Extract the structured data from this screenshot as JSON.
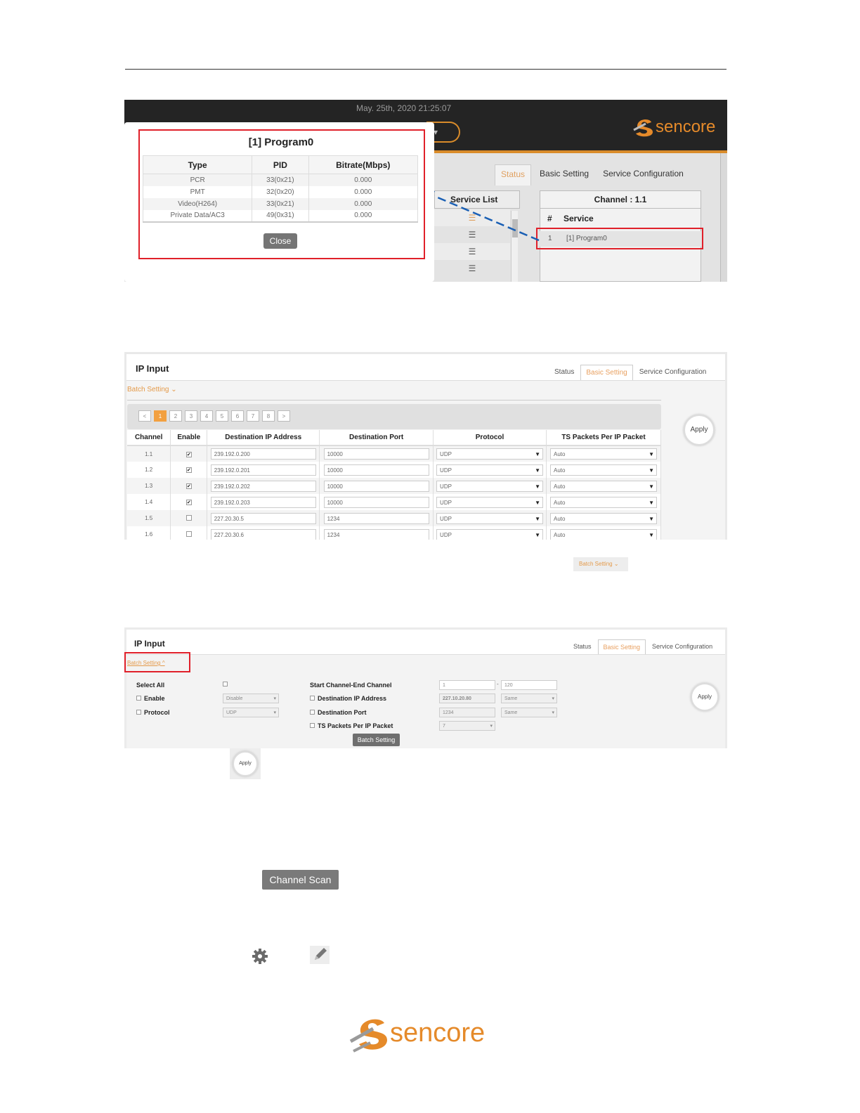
{
  "shot1": {
    "datetime": "May. 25th, 2020 21:25:07",
    "brand": "sencore",
    "tabs": [
      {
        "label": "Status",
        "active": true
      },
      {
        "label": "Basic Setting",
        "active": false
      },
      {
        "label": "Service Configuration",
        "active": false
      }
    ],
    "service_list_title": "Service List",
    "channel_title": "Channel : 1.1",
    "col_hash": "#",
    "col_service": "Service",
    "row_num": "1",
    "row_service": "[1] Program0",
    "popup": {
      "title": "[1] Program0",
      "headers": [
        "Type",
        "PID",
        "Bitrate(Mbps)"
      ],
      "rows": [
        [
          "PCR",
          "33(0x21)",
          "0.000"
        ],
        [
          "PMT",
          "32(0x20)",
          "0.000"
        ],
        [
          "Video(H264)",
          "33(0x21)",
          "0.000"
        ],
        [
          "Private Data/AC3",
          "49(0x31)",
          "0.000"
        ]
      ],
      "close_label": "Close"
    }
  },
  "shot2": {
    "title": "IP Input",
    "tabs": [
      {
        "label": "Status",
        "active": false
      },
      {
        "label": "Basic Setting",
        "active": true
      },
      {
        "label": "Service Configuration",
        "active": false
      }
    ],
    "batch_label": "Batch Setting",
    "pager": [
      "<",
      "1",
      "2",
      "3",
      "4",
      "5",
      "6",
      "7",
      "8",
      ">"
    ],
    "apply_label": "Apply",
    "headers": [
      "Channel",
      "Enable",
      "Destination IP Address",
      "Destination Port",
      "Protocol",
      "TS Packets Per IP Packet"
    ],
    "rows": [
      {
        "channel": "1.1",
        "enabled": true,
        "ip": "239.192.0.200",
        "port": "10000",
        "protocol": "UDP",
        "ts": "Auto"
      },
      {
        "channel": "1.2",
        "enabled": true,
        "ip": "239.192.0.201",
        "port": "10000",
        "protocol": "UDP",
        "ts": "Auto"
      },
      {
        "channel": "1.3",
        "enabled": true,
        "ip": "239.192.0.202",
        "port": "10000",
        "protocol": "UDP",
        "ts": "Auto"
      },
      {
        "channel": "1.4",
        "enabled": true,
        "ip": "239.192.0.203",
        "port": "10000",
        "protocol": "UDP",
        "ts": "Auto"
      },
      {
        "channel": "1.5",
        "enabled": false,
        "ip": "227.20.30.5",
        "port": "1234",
        "protocol": "UDP",
        "ts": "Auto"
      },
      {
        "channel": "1.6",
        "enabled": false,
        "ip": "227.20.30.6",
        "port": "1234",
        "protocol": "UDP",
        "ts": "Auto"
      }
    ]
  },
  "batch_small_label": "Batch Setting",
  "shot3": {
    "title": "IP Input",
    "tabs": [
      {
        "label": "Status",
        "active": false
      },
      {
        "label": "Basic Setting",
        "active": true
      },
      {
        "label": "Service Configuration",
        "active": false
      }
    ],
    "batch_label": "Batch Setting",
    "select_all": "Select All",
    "enable_label": "Enable",
    "enable_value": "Disable",
    "protocol_label": "Protocol",
    "protocol_value": "UDP",
    "start_end_label": "Start Channel-End Channel",
    "start_value": "1",
    "range_sep": "-",
    "end_value": "120",
    "dest_ip_label": "Destination IP Address",
    "dest_ip_value": "227.10.20.80",
    "dest_ip_mode": "Same",
    "dest_port_label": "Destination Port",
    "dest_port_value": "1234",
    "dest_port_mode": "Same",
    "ts_label": "TS Packets Per IP Packet",
    "ts_value": "7",
    "batch_button": "Batch Setting",
    "apply_label": "Apply"
  },
  "apply_small_label": "Apply",
  "channel_scan_label": "Channel Scan",
  "footer_brand": "sencore",
  "colors": {
    "accent": "#d98b2a",
    "highlight": "#e0202a",
    "link": "#e49a4a"
  }
}
